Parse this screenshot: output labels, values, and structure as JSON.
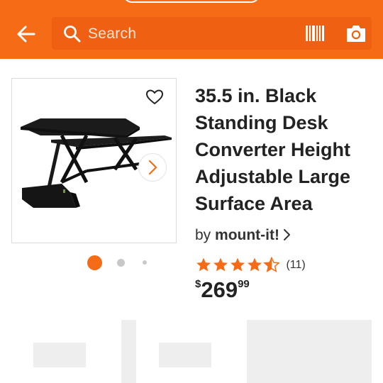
{
  "header": {
    "search_placeholder": "Search",
    "back_icon": "back-arrow-icon",
    "search_icon": "search-icon",
    "barcode_icon": "barcode-scan-icon",
    "camera_icon": "camera-icon",
    "accent_color": "#f56b16"
  },
  "product": {
    "title": "35.5 in. Black Standing Desk Converter Height Adjustable Large Surface Area",
    "brand_prefix": "by ",
    "brand": "mount-it!",
    "rating": 4.5,
    "review_count": "(11)",
    "price": {
      "currency": "$",
      "dollars": "269",
      "cents": "99"
    },
    "gallery": {
      "active_index": 0,
      "total_dots": 3
    }
  }
}
